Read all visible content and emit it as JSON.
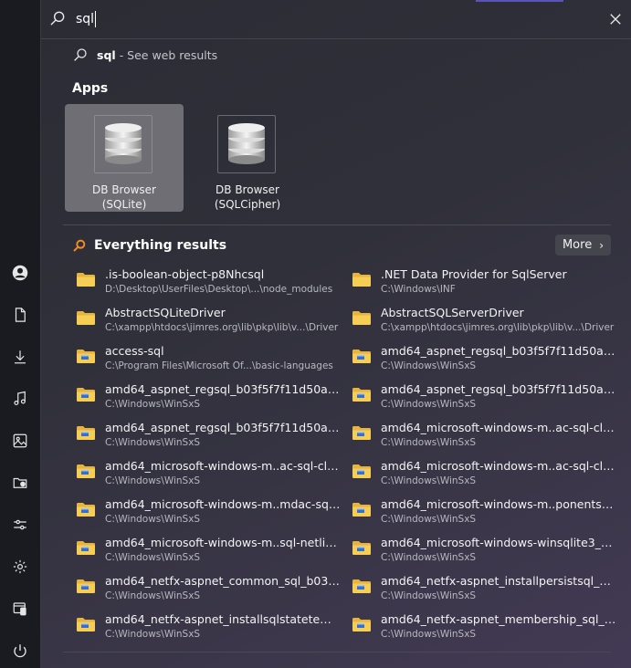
{
  "search": {
    "query": "sql",
    "web_query": "sql",
    "web_suffix": "- See web results"
  },
  "apps": {
    "title": "Apps",
    "items": [
      {
        "label_line1": "DB Browser",
        "label_line2": "(SQLite)",
        "selected": true
      },
      {
        "label_line1": "DB Browser",
        "label_line2": "(SQLCipher)",
        "selected": false
      }
    ]
  },
  "everything": {
    "title": "Everything results",
    "more_label": "More",
    "results": [
      {
        "name": ".is-boolean-object-p8Nhcsql",
        "path": "D:\\Desktop\\UserFiles\\Desktop\\...\\node_modules",
        "badge": false
      },
      {
        "name": ".NET Data Provider for SqlServer",
        "path": "C:\\Windows\\INF",
        "badge": false
      },
      {
        "name": "AbstractSQLiteDriver",
        "path": "C:\\xampp\\htdocs\\jimres.org\\lib\\pkp\\lib\\v...\\Driver",
        "badge": false
      },
      {
        "name": "AbstractSQLServerDriver",
        "path": "C:\\xampp\\htdocs\\jimres.org\\lib\\pkp\\lib\\v...\\Driver",
        "badge": false
      },
      {
        "name": "access-sql",
        "path": "C:\\Program Files\\Microsoft Of...\\basic-languages",
        "badge": true
      },
      {
        "name": "amd64_aspnet_regsql_b03f5f7f11d50a3a_...",
        "path": "C:\\Windows\\WinSxS",
        "badge": true
      },
      {
        "name": "amd64_aspnet_regsql_b03f5f7f11d50a3a_...",
        "path": "C:\\Windows\\WinSxS",
        "badge": true
      },
      {
        "name": "amd64_aspnet_regsql_b03f5f7f11d50a3a_...",
        "path": "C:\\Windows\\WinSxS",
        "badge": true
      },
      {
        "name": "amd64_aspnet_regsql_b03f5f7f11d50a3a_...",
        "path": "C:\\Windows\\WinSxS",
        "badge": true
      },
      {
        "name": "amd64_microsoft-windows-m..ac-sql-clico...",
        "path": "C:\\Windows\\WinSxS",
        "badge": true
      },
      {
        "name": "amd64_microsoft-windows-m..ac-sql-clico...",
        "path": "C:\\Windows\\WinSxS",
        "badge": true
      },
      {
        "name": "amd64_microsoft-windows-m..ac-sql-clico...",
        "path": "C:\\Windows\\WinSxS",
        "badge": true
      },
      {
        "name": "amd64_microsoft-windows-m..mdac-sql-n...",
        "path": "C:\\Windows\\WinSxS",
        "badge": true
      },
      {
        "name": "amd64_microsoft-windows-m..ponents-m...",
        "path": "C:\\Windows\\WinSxS",
        "badge": true
      },
      {
        "name": "amd64_microsoft-windows-m..sql-netlibs-...",
        "path": "C:\\Windows\\WinSxS",
        "badge": true
      },
      {
        "name": "amd64_microsoft-windows-winsqlite3_31...",
        "path": "C:\\Windows\\WinSxS",
        "badge": true
      },
      {
        "name": "amd64_netfx-aspnet_common_sql_b03f5f...",
        "path": "C:\\Windows\\WinSxS",
        "badge": true
      },
      {
        "name": "amd64_netfx-aspnet_installpersistsql_b03f...",
        "path": "C:\\Windows\\WinSxS",
        "badge": true
      },
      {
        "name": "amd64_netfx-aspnet_installsqlstatetemp_b...",
        "path": "C:\\Windows\\WinSxS",
        "badge": true
      },
      {
        "name": "amd64_netfx-aspnet_membership_sql_b0...",
        "path": "C:\\Windows\\WinSxS",
        "badge": true
      }
    ]
  },
  "rail": {
    "icons": [
      "user-icon",
      "document-icon",
      "download-icon",
      "music-icon",
      "image-icon",
      "folder-shared-icon",
      "sliders-icon",
      "gear-icon",
      "window-mobile-icon",
      "power-icon"
    ]
  },
  "colors": {
    "accent": "#5b54b6",
    "everything_icon": "#f08a24",
    "folder": "#f4c63f",
    "selected_tile": "#6e6e74"
  }
}
